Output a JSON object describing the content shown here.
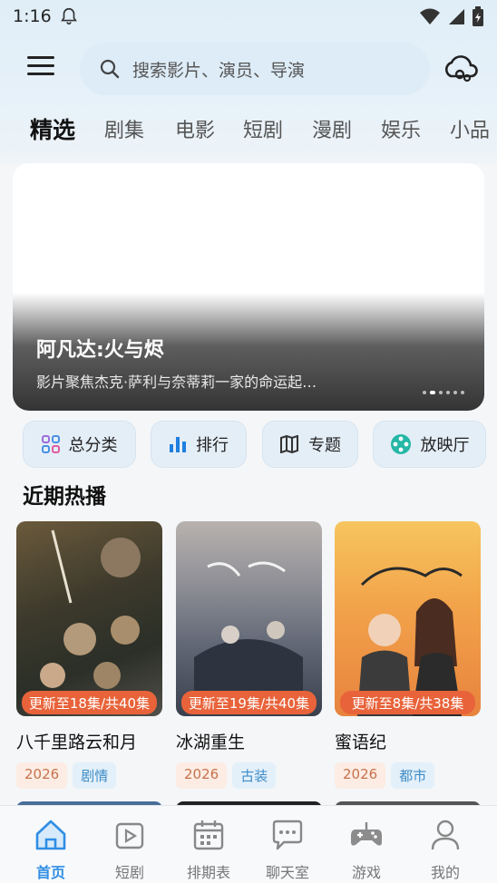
{
  "status": {
    "time": "1:16"
  },
  "search": {
    "placeholder": "搜索影片、演员、导演"
  },
  "tabs": [
    {
      "label": "精选",
      "active": true
    },
    {
      "label": "剧集"
    },
    {
      "label": "电影"
    },
    {
      "label": "短剧"
    },
    {
      "label": "漫剧"
    },
    {
      "label": "娱乐"
    },
    {
      "label": "小品"
    }
  ],
  "banner": {
    "title": "阿凡达:火与烬",
    "description": "影片聚焦杰克·萨利与奈蒂莉一家的命运起…"
  },
  "quick_links": [
    {
      "label": "总分类",
      "icon": "grid-icon"
    },
    {
      "label": "排行",
      "icon": "bar-chart-icon"
    },
    {
      "label": "专题",
      "icon": "map-book-icon"
    },
    {
      "label": "放映厅",
      "icon": "film-reel-icon"
    }
  ],
  "section": {
    "title": "近期热播"
  },
  "cards": [
    {
      "title": "八千里路云和月",
      "badge": "更新至18集/共40集",
      "year": "2026",
      "genre": "剧情"
    },
    {
      "title": "冰湖重生",
      "badge": "更新至19集/共40集",
      "year": "2026",
      "genre": "古装"
    },
    {
      "title": "蜜语纪",
      "badge": "更新至8集/共38集",
      "year": "2026",
      "genre": "都市"
    }
  ],
  "bottom_nav": [
    {
      "label": "首页",
      "icon": "home-icon",
      "active": true
    },
    {
      "label": "短剧",
      "icon": "short-video-icon"
    },
    {
      "label": "排期表",
      "icon": "calendar-icon"
    },
    {
      "label": "聊天室",
      "icon": "chat-icon"
    },
    {
      "label": "游戏",
      "icon": "gamepad-icon"
    },
    {
      "label": "我的",
      "icon": "user-icon"
    }
  ],
  "colors": {
    "accent": "#2f8ee4",
    "badge": "#e8633a"
  }
}
